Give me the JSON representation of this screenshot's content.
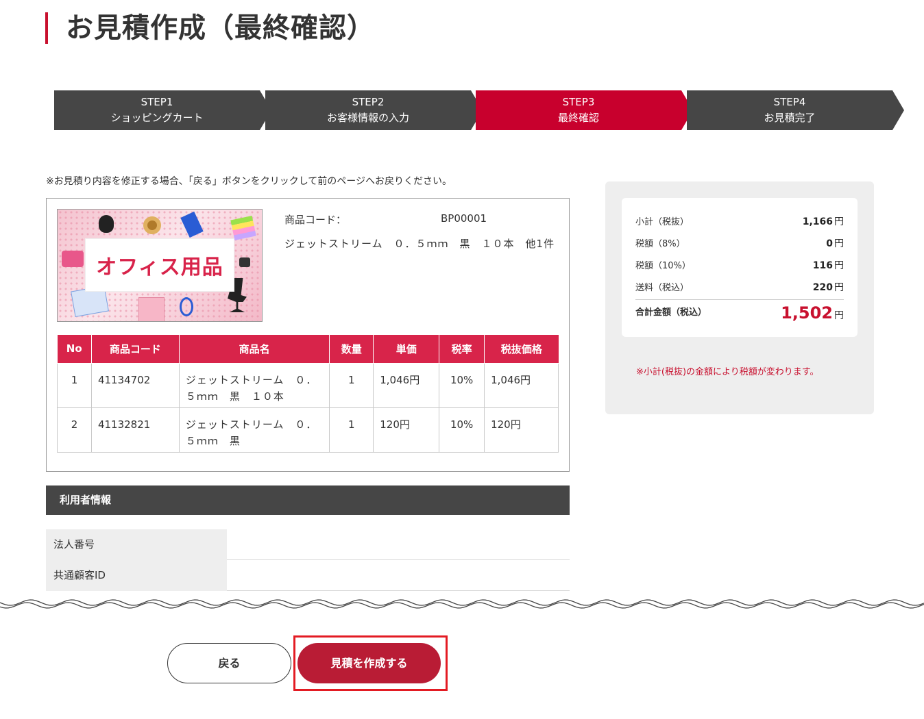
{
  "page_title": "お見積作成（最終確認）",
  "steps": [
    {
      "num": "STEP1",
      "name": "ショッピングカート",
      "active": false
    },
    {
      "num": "STEP2",
      "name": "お客様情報の入力",
      "active": false
    },
    {
      "num": "STEP3",
      "name": "最終確認",
      "active": true
    },
    {
      "num": "STEP4",
      "name": "お見積完了",
      "active": false
    }
  ],
  "note": "※お見積り内容を修正する場合、「戻る」ボタンをクリックして前のページへお戻りください。",
  "product": {
    "image_text": "オフィス用品",
    "code_label": "商品コード：",
    "code_value": "BP00001",
    "name": "ジェットストリーム　０．５ｍｍ　黒　１０本　他1件"
  },
  "items_table": {
    "headers": [
      "No",
      "商品コード",
      "商品名",
      "数量",
      "単価",
      "税率",
      "税抜価格"
    ],
    "rows": [
      {
        "no": "1",
        "code": "41134702",
        "name": "ジェットストリーム　０．５ｍｍ　黒　１０本",
        "qty": "1",
        "unit_price": "1,046円",
        "tax_rate": "10%",
        "price": "1,046円"
      },
      {
        "no": "2",
        "code": "41132821",
        "name": "ジェットストリーム　０．５ｍｍ　黒",
        "qty": "1",
        "unit_price": "120円",
        "tax_rate": "10%",
        "price": "120円"
      }
    ]
  },
  "user_info": {
    "header": "利用者情報",
    "rows": [
      {
        "label": "法人番号",
        "value": ""
      },
      {
        "label": "共通顧客ID",
        "value": ""
      }
    ]
  },
  "summary": {
    "rows": [
      {
        "label": "小計（税抜）",
        "value": "1,166",
        "unit": "円"
      },
      {
        "label": "税額（8%）",
        "value": "0",
        "unit": "円"
      },
      {
        "label": "税額（10%）",
        "value": "116",
        "unit": "円"
      },
      {
        "label": "送料（税込）",
        "value": "220",
        "unit": "円"
      }
    ],
    "total_label": "合計金額（税込）",
    "total_value": "1,502",
    "total_unit": "円",
    "note": "※小計(税抜)の金額により税額が変わります。"
  },
  "buttons": {
    "back": "戻る",
    "create": "見積を作成する"
  },
  "colors": {
    "accent": "#c8002d",
    "dark": "#464646",
    "table_header": "#d8244a",
    "highlight": "#e31b23"
  }
}
